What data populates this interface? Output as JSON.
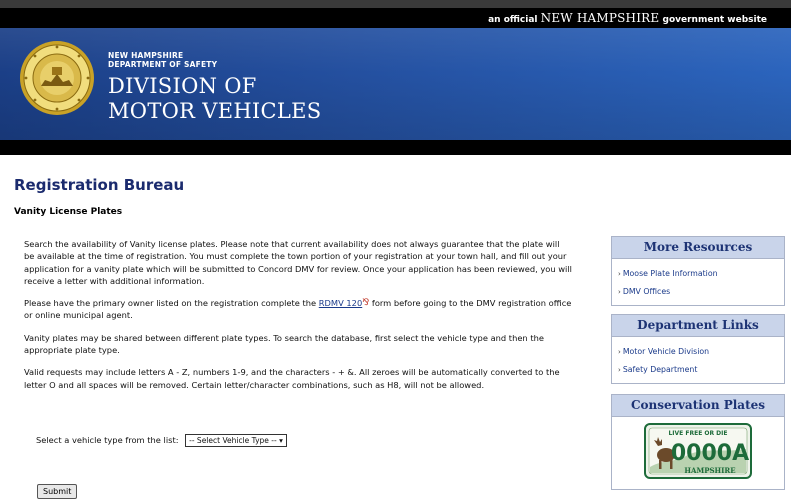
{
  "gov_bar": {
    "prefix": "an official",
    "state": "NEW HAMPSHIRE",
    "suffix": "government website"
  },
  "header": {
    "line1": "NEW HAMPSHIRE",
    "line2": "DEPARTMENT OF SAFETY",
    "title1": "DIVISION OF",
    "title2": "MOTOR VEHICLES"
  },
  "page": {
    "title": "Registration Bureau",
    "subtitle": "Vanity License Plates"
  },
  "content": {
    "p1": "Search the availability of Vanity license plates. Please note that current availability does not always guarantee that the plate will be available at the time of registration. You must complete the town portion of your registration at your town hall, and fill out your application for a vanity plate which will be submitted to Concord DMV for review. Once your application has been reviewed, you will receive a letter with additional information.",
    "p2_before": "Please have the primary owner listed on the registration complete the",
    "p2_link": "RDMV 120",
    "p2_after": "form before going to the DMV registration office or online municipal agent.",
    "p3": "Vanity plates may be shared between different plate types. To search the database, first select the vehicle type and then the appropriate plate type.",
    "p4": "Valid requests may include letters A - Z, numbers 1-9, and the characters - + &. All zeroes will be automatically converted to the letter O and all spaces will be removed. Certain letter/character combinations, such as H8, will not be allowed."
  },
  "form": {
    "select_label": "Select a vehicle type from the list:",
    "select_value": "-- Select Vehicle Type --",
    "submit_label": "Submit"
  },
  "sidebar": {
    "resources": {
      "heading": "More Resources",
      "items": [
        {
          "label": "Moose Plate Information"
        },
        {
          "label": "DMV Offices"
        }
      ]
    },
    "dept": {
      "heading": "Department Links",
      "items": [
        {
          "label": "Motor Vehicle Division"
        },
        {
          "label": "Safety Department"
        }
      ]
    },
    "conservation": {
      "heading": "Conservation Plates",
      "plate_top": "LIVE FREE OR DIE",
      "plate_number": "0000A",
      "plate_bottom": "HAMPSHIRE"
    }
  },
  "colors": {
    "banner": "#2450a0",
    "title": "#1b2b6e",
    "link": "#1a3a8a",
    "panel_header": "#c9d4ea",
    "plate_green": "#1d6b3a"
  }
}
